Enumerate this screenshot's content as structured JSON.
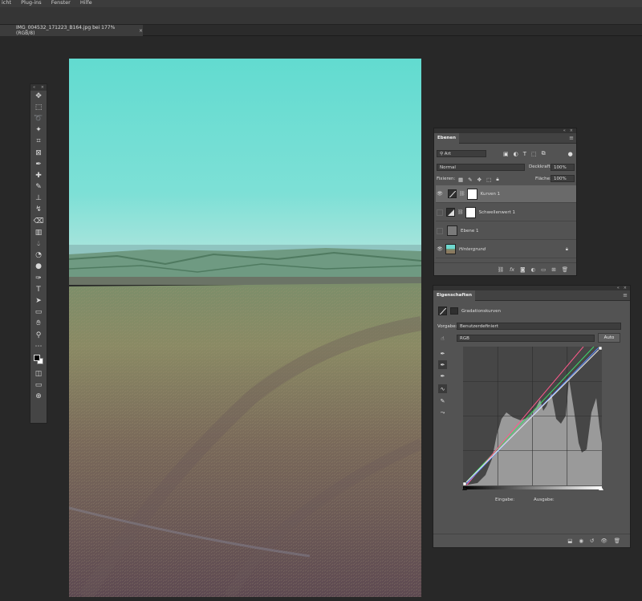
{
  "menu": {
    "items": [
      "icht",
      "Plug-ins",
      "Fenster",
      "Hilfe"
    ]
  },
  "document": {
    "tab_title": "IMG_004532_171223_B164.jpg bei 177% (RGB/8)",
    "close_glyph": "×"
  },
  "toolbar": {
    "tools": [
      "move-icon",
      "marquee-icon",
      "lasso-icon",
      "quick-select-icon",
      "crop-icon",
      "frame-icon",
      "eyedropper-icon",
      "healing-icon",
      "brush-icon",
      "stamp-icon",
      "history-brush-icon",
      "eraser-icon",
      "gradient-icon",
      "blur-icon",
      "dodge-icon",
      "burn-icon",
      "pen-icon",
      "type-icon",
      "path-select-icon",
      "rectangle-icon",
      "hand-icon",
      "zoom-icon",
      "more-icon"
    ]
  },
  "layers_panel": {
    "tab": "Ebenen",
    "filter_kind": "Art",
    "blend_mode": "Normal",
    "opacity_label": "Deckkraft:",
    "opacity_value": "100%",
    "lock_label": "Fixieren:",
    "fill_label": "Fläche:",
    "fill_value": "100%",
    "layers": [
      {
        "name": "Kurven 1",
        "visible": true,
        "selected": true,
        "type": "curves"
      },
      {
        "name": "Schwellenwert 1",
        "visible": false,
        "selected": false,
        "type": "threshold"
      },
      {
        "name": "Ebene 1",
        "visible": false,
        "selected": false,
        "type": "pixel"
      },
      {
        "name": "Hintergrund",
        "visible": true,
        "selected": false,
        "type": "background",
        "locked": true
      }
    ]
  },
  "properties_panel": {
    "tab": "Eigenschaften",
    "title": "Gradationskurven",
    "preset_label": "Vorgabe:",
    "preset_value": "Benutzerdefiniert",
    "channel": "RGB",
    "auto_button": "Auto",
    "input_label": "Eingabe:",
    "output_label": "Ausgabe:"
  },
  "colors": {
    "panel_bg": "#535353",
    "curve_bg": "#464646",
    "histogram": "#9a9a9a",
    "curve_rgb": "#e8e8e8",
    "curve_red": "#ff5a8c",
    "curve_green": "#3ddc6a",
    "curve_blue": "#5a8cff"
  }
}
